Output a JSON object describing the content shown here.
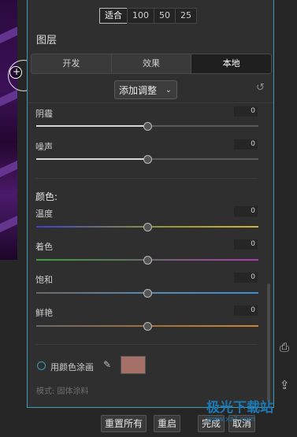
{
  "zoom_options": [
    "适合",
    "100",
    "50",
    "25"
  ],
  "layers_title": "图层",
  "tabs": [
    "开发",
    "效果",
    "本地"
  ],
  "adjust_label": "添加调整",
  "noise_sliders": [
    {
      "label": "阴霾",
      "value": "0"
    },
    {
      "label": "噪声",
      "value": "0"
    }
  ],
  "color_title": "颜色:",
  "color_sliders": [
    {
      "label": "温度",
      "value": "0",
      "track_color": "linear-gradient(90deg,#3a3fd0,#8a8f3a,#d1b33a)"
    },
    {
      "label": "着色",
      "value": "0",
      "track_color": "linear-gradient(90deg,#3aa23a,#6a6a6a,#b03ab0)"
    },
    {
      "label": "饱和",
      "value": "0",
      "track_color": "linear-gradient(90deg,#6a6a6a,#5a8ab0,#3a8fd0)"
    },
    {
      "label": "鲜艳",
      "value": "0",
      "track_color": "linear-gradient(90deg,#6a6a6a,#a0703a,#d0843a)"
    }
  ],
  "fill": {
    "label": "用颜色涂画",
    "mode": "模式: 固体涂料",
    "swatch_color": "#a57068"
  },
  "bottom_buttons": [
    "重置所有",
    "重启",
    "完成",
    "取消"
  ],
  "watermark": {
    "text": "极光下载站",
    "subtext": "www.xz7.com"
  }
}
